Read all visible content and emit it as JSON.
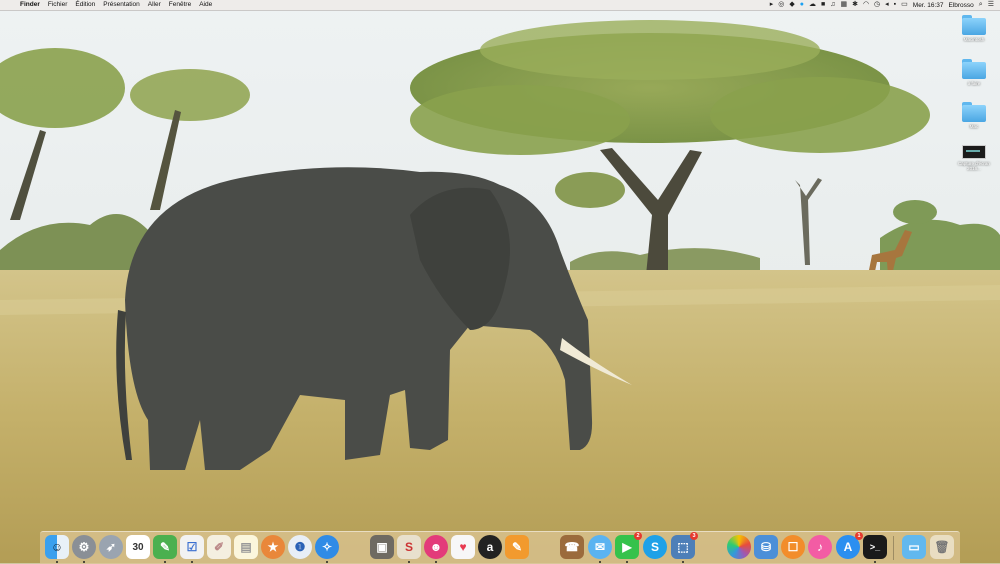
{
  "menubar": {
    "app_name": "Finder",
    "menus": [
      "Fichier",
      "Édition",
      "Présentation",
      "Aller",
      "Fenêtre",
      "Aide"
    ],
    "clock": "Mer. 16:37",
    "user": "Elbrosso"
  },
  "desktop": {
    "icons": [
      {
        "label": "Macintosh",
        "kind": "folder"
      },
      {
        "label": "à faire",
        "kind": "folder"
      },
      {
        "label": "Mac",
        "kind": "folder"
      },
      {
        "label": "Capture d'écran 2016...",
        "kind": "image"
      }
    ]
  },
  "dock": {
    "apps": [
      {
        "name": "finder"
      },
      {
        "name": "system-preferences"
      },
      {
        "name": "launchpad"
      },
      {
        "name": "calendar",
        "text": "30"
      },
      {
        "name": "evernote"
      },
      {
        "name": "omnifocus"
      },
      {
        "name": "textedit"
      },
      {
        "name": "notes"
      },
      {
        "name": "reeder"
      },
      {
        "name": "1password"
      },
      {
        "name": "safari"
      },
      {
        "name": "archive"
      },
      {
        "name": "scrivener"
      },
      {
        "name": "tweetbot"
      },
      {
        "name": "pocket"
      },
      {
        "name": "amazon"
      },
      {
        "name": "pages"
      },
      {
        "name": "contacts"
      },
      {
        "name": "messages"
      },
      {
        "name": "facetime",
        "badge": "2"
      },
      {
        "name": "skype"
      },
      {
        "name": "preview",
        "badge": "3"
      },
      {
        "name": "photos"
      },
      {
        "name": "disk-utility"
      },
      {
        "name": "ibooks"
      },
      {
        "name": "itunes"
      },
      {
        "name": "app-store",
        "badge": "1"
      },
      {
        "name": "terminal"
      },
      {
        "name": "downloads-folder"
      },
      {
        "name": "trash"
      }
    ]
  }
}
